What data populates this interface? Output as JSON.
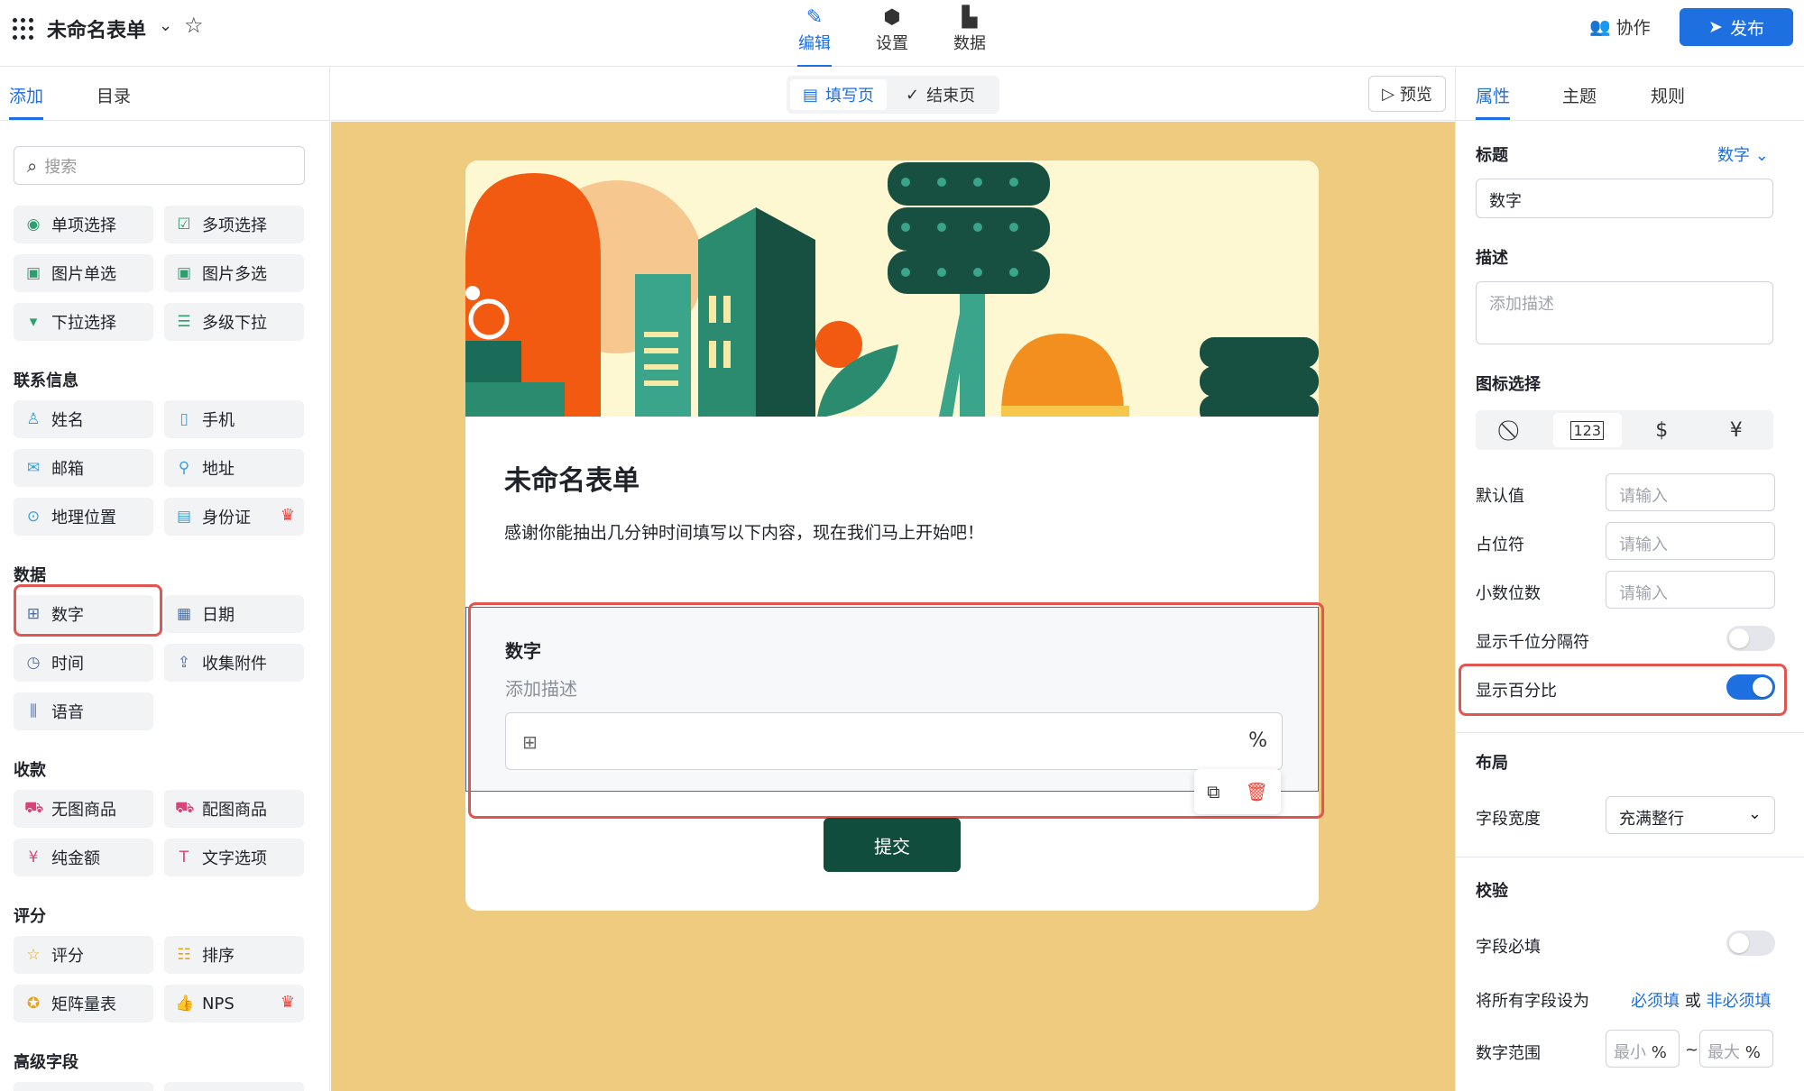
{
  "app": {
    "title": "未命名表单",
    "mode_tabs": [
      {
        "label": "编辑",
        "icon": "pencil-icon"
      },
      {
        "label": "设置",
        "icon": "hexagon-settings-icon"
      },
      {
        "label": "数据",
        "icon": "bar-chart-icon"
      }
    ],
    "collab_label": "协作",
    "publish_label": "发布"
  },
  "left": {
    "tabs": [
      "添加",
      "目录"
    ],
    "search_placeholder": "搜索",
    "fields": {
      "single_choice": "单项选择",
      "multi_choice": "多项选择",
      "image_single": "图片单选",
      "image_multi": "图片多选",
      "dropdown": "下拉选择",
      "cascade": "多级下拉"
    },
    "sections": {
      "contact": "联系信息",
      "data": "数据",
      "payment": "收款",
      "rating": "评分",
      "advanced": "高级字段"
    },
    "contact_fields": {
      "name": "姓名",
      "phone": "手机",
      "email": "邮箱",
      "address": "地址",
      "location": "地理位置",
      "id_card": "身份证"
    },
    "data_fields": {
      "number": "数字",
      "date": "日期",
      "time": "时间",
      "attachment": "收集附件",
      "voice": "语音"
    },
    "payment_fields": {
      "product_no_image": "无图商品",
      "product_with_image": "配图商品",
      "amount": "纯金额",
      "text_option": "文字选项"
    },
    "rating_fields": {
      "score": "评分",
      "rank": "排序",
      "matrix": "矩阵量表",
      "nps": "NPS"
    }
  },
  "canvas": {
    "page_tabs": [
      "填写页",
      "结束页"
    ],
    "preview_label": "预览",
    "form_title": "未命名表单",
    "form_desc": "感谢你能抽出几分钟时间填写以下内容，现在我们马上开始吧！",
    "question": {
      "title": "数字",
      "desc": "添加描述",
      "suffix": "%"
    },
    "submit_label": "提交",
    "bg_color": "#eecb7e",
    "submit_color": "#114d3d"
  },
  "right": {
    "tabs": [
      "属性",
      "主题",
      "规则"
    ],
    "title_label": "标题",
    "type_value": "数字",
    "title_value": "数字",
    "desc_label": "描述",
    "desc_placeholder": "添加描述",
    "icon_label": "图标选择",
    "icon_options": [
      "⃠",
      "123",
      "$",
      "¥"
    ],
    "default_label": "默认值",
    "default_placeholder": "请输入",
    "placeholder_label": "占位符",
    "placeholder_placeholder": "请输入",
    "decimal_label": "小数位数",
    "decimal_placeholder": "请输入",
    "thousands_label": "显示千位分隔符",
    "thousands_on": false,
    "percent_label": "显示百分比",
    "percent_on": true,
    "layout_label": "布局",
    "width_label": "字段宽度",
    "width_value": "充满整行",
    "validate_label": "校验",
    "required_label": "字段必填",
    "required_on": false,
    "set_all_label": "将所有字段设为",
    "required_link": "必须填",
    "or_text": "或",
    "optional_link": "非必须填",
    "range_label": "数字范围",
    "range_min": "最小",
    "range_max": "最大",
    "range_pct": "%",
    "range_sep": "~"
  },
  "colors": {
    "accent": "#1e6fe0",
    "highlight": "#e2564f"
  }
}
